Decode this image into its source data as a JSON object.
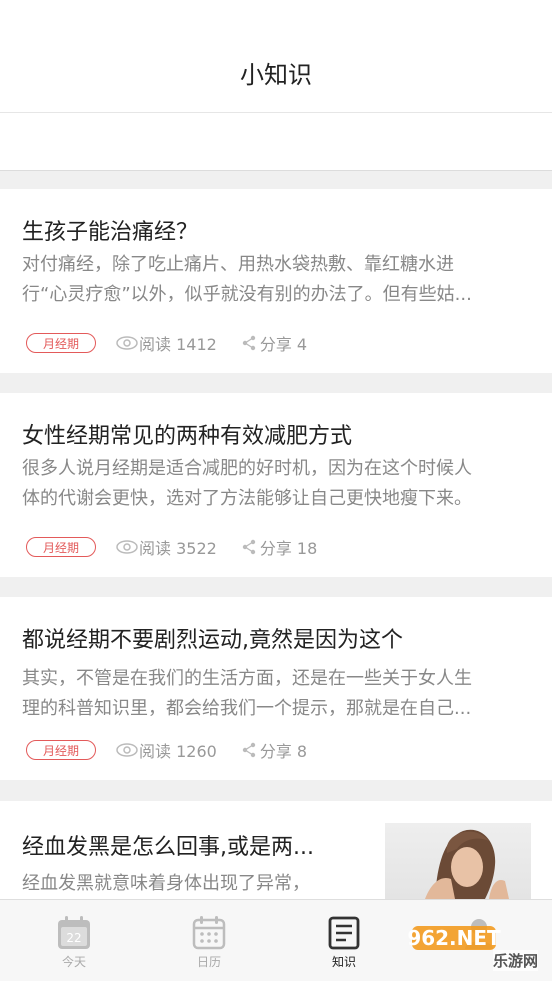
{
  "header": {
    "title": "小知识"
  },
  "articles": [
    {
      "title": "生孩子能治痛经？",
      "summary_line1": "对付痛经，除了吃止痛片、用热水袋热敷、靠红糖水进",
      "summary_line2": "行“心灵疗愈”以外，似乎就没有别的办法了。但有些姑...",
      "tag": "月经期",
      "reads": "阅读 1412",
      "shares": "分享 4"
    },
    {
      "title": "女性经期常见的两种有效减肥方式",
      "summary_line1": "很多人说月经期是适合减肥的好时机，因为在这个时候人",
      "summary_line2": "体的代谢会更快，选对了方法能够让自己更快地瘦下来。",
      "tag": "月经期",
      "reads": "阅读 3522",
      "shares": "分享 18"
    },
    {
      "title": "都说经期不要剧烈运动,竟然是因为这个",
      "summary_line1": "其实，不管是在我们的生活方面，还是在一些关于女人生",
      "summary_line2": "理的科普知识里，都会给我们一个提示，那就是在自己...",
      "tag": "月经期",
      "reads": "阅读 1260",
      "shares": "分享 8"
    },
    {
      "title": "经血发黑是怎么回事,或是两...",
      "summary_line1": "经血发黑就意味着身体出现了异常，"
    }
  ],
  "tabbar": {
    "tabs": [
      {
        "label": "今天",
        "icon": "calendar-today-icon",
        "badge": "22"
      },
      {
        "label": "日历",
        "icon": "calendar-grid-icon"
      },
      {
        "label": "知识",
        "icon": "article-icon",
        "active": true
      },
      {
        "label": "",
        "icon": "user-icon"
      }
    ]
  },
  "watermark": {
    "text": "乐游网",
    "logo": "962.NET"
  },
  "colors": {
    "tag": "#e35a5a",
    "title": "#222222",
    "summary": "#888888",
    "meta": "#999999"
  }
}
